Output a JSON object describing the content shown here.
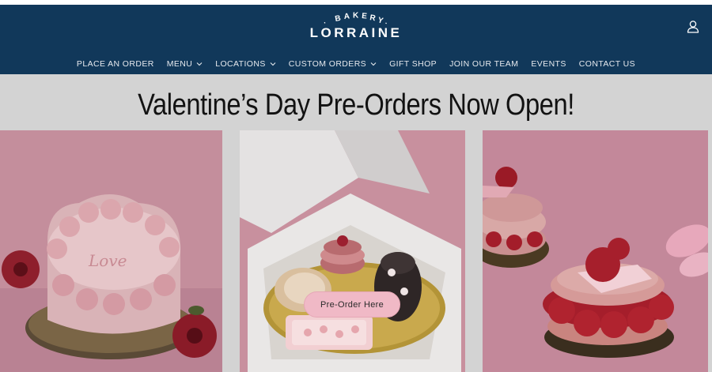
{
  "brand": {
    "arc_text": "BAKERY",
    "name": "LORRAINE"
  },
  "account": {
    "icon": "user-icon"
  },
  "nav": {
    "items": [
      {
        "label": "PLACE AN ORDER",
        "dropdown": false
      },
      {
        "label": "MENU",
        "dropdown": true
      },
      {
        "label": "LOCATIONS",
        "dropdown": true
      },
      {
        "label": "CUSTOM ORDERS",
        "dropdown": true
      },
      {
        "label": "GIFT SHOP",
        "dropdown": false
      },
      {
        "label": "JOIN OUR TEAM",
        "dropdown": false
      },
      {
        "label": "EVENTS",
        "dropdown": false
      },
      {
        "label": "CONTACT US",
        "dropdown": false
      }
    ]
  },
  "hero": {
    "title": "Valentine’s Day Pre-Orders Now Open!",
    "cta_label": "Pre-Order Here",
    "cake_text": "Love"
  },
  "colors": {
    "header_bg": "#11385a",
    "page_bg": "#d3d3d3",
    "cta_bg": "#f0b9c6",
    "pink_backdrop": "#c48e9c"
  }
}
